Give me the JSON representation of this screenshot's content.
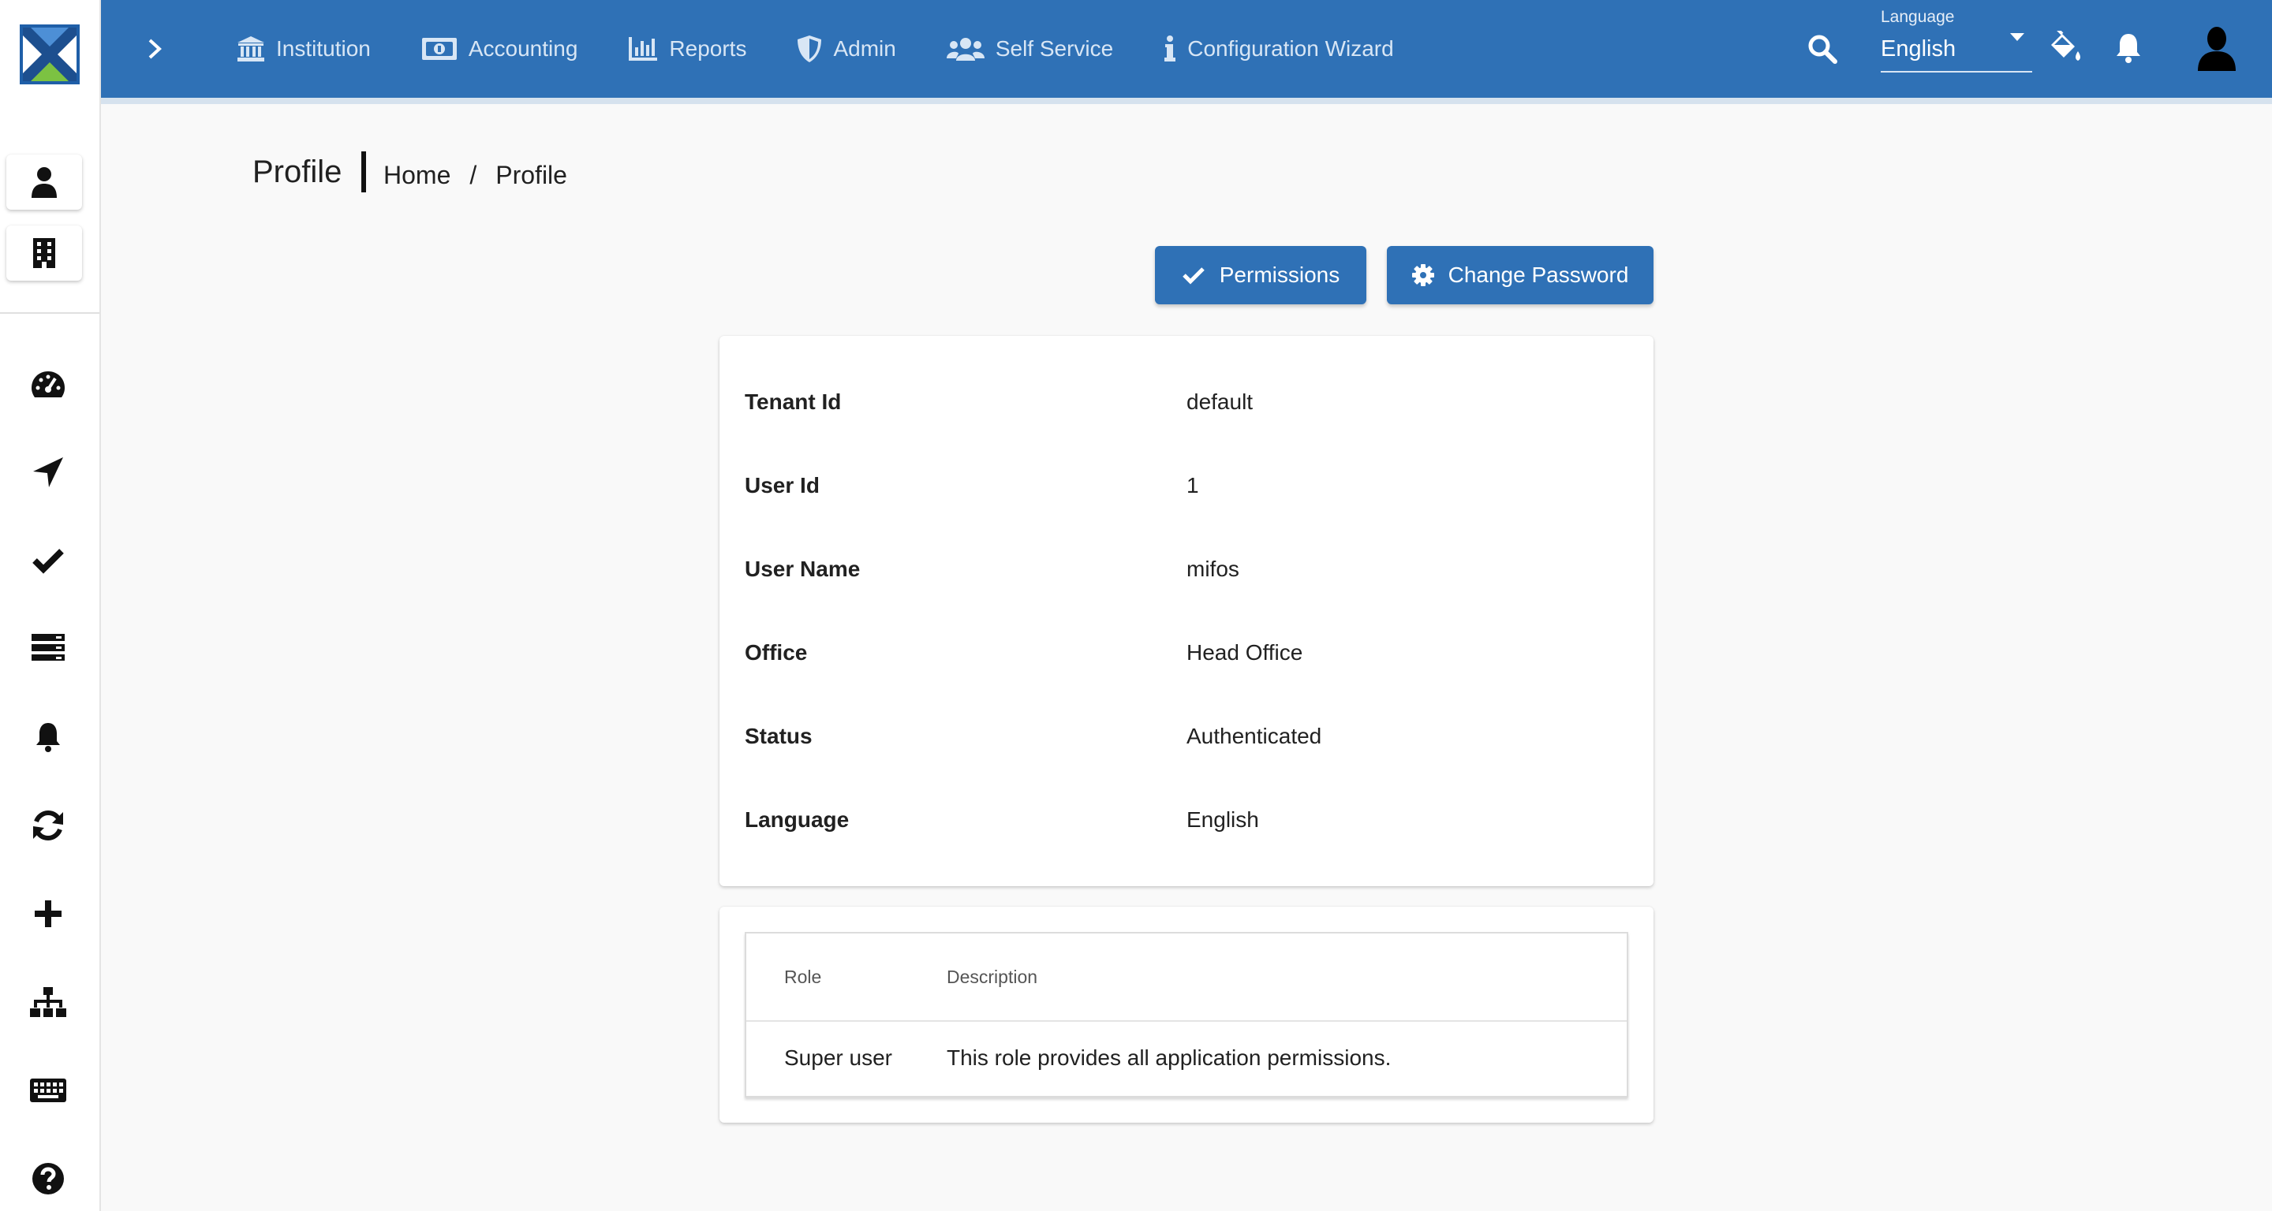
{
  "nav": {
    "items": [
      {
        "label": "Institution",
        "icon": "bank-icon"
      },
      {
        "label": "Accounting",
        "icon": "money-icon"
      },
      {
        "label": "Reports",
        "icon": "chart-icon"
      },
      {
        "label": "Admin",
        "icon": "shield-icon"
      },
      {
        "label": "Self Service",
        "icon": "users-icon"
      },
      {
        "label": "Configuration Wizard",
        "icon": "info-icon"
      }
    ]
  },
  "language_select": {
    "label": "Language",
    "value": "English"
  },
  "page": {
    "title": "Profile",
    "breadcrumb": {
      "home": "Home",
      "separator": "/",
      "current": "Profile"
    }
  },
  "actions": {
    "permissions": "Permissions",
    "change_password": "Change Password"
  },
  "profile": {
    "rows": [
      {
        "key": "Tenant Id",
        "value": "default"
      },
      {
        "key": "User Id",
        "value": "1"
      },
      {
        "key": "User Name",
        "value": "mifos"
      },
      {
        "key": "Office",
        "value": "Head Office"
      },
      {
        "key": "Status",
        "value": "Authenticated"
      },
      {
        "key": "Language",
        "value": "English"
      }
    ]
  },
  "roles": {
    "columns": [
      "Role",
      "Description"
    ],
    "rows": [
      {
        "role": "Super user",
        "description": "This role provides all application permissions."
      }
    ]
  },
  "colors": {
    "primary": "#2f71b6",
    "background": "#f9f9f9"
  }
}
